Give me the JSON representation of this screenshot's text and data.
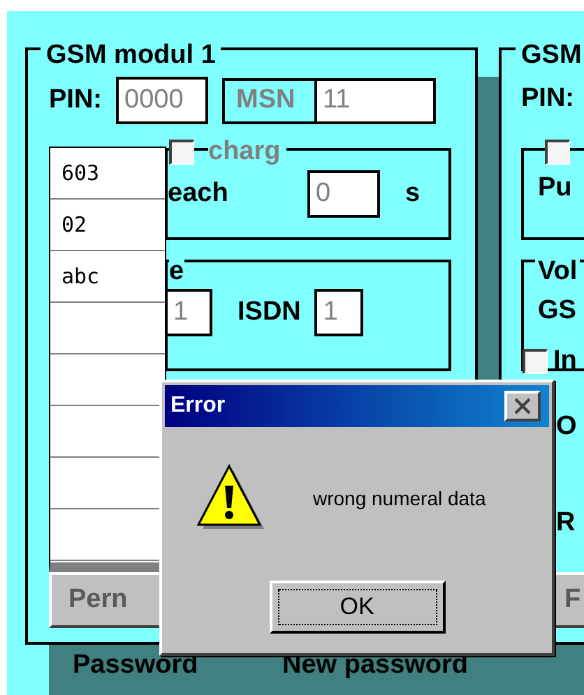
{
  "left_module": {
    "title": "GSM modul 1",
    "pin_label": "PIN:",
    "pin_value": "0000",
    "msn_label": "MSN",
    "msn_value": "11",
    "call_charge": {
      "label": "charg",
      "checked": false
    },
    "interval_label": "each",
    "interval_value": "0",
    "interval_unit": "s",
    "line_group_title": "e",
    "gsm_value": "1",
    "isdn_label": "ISDN",
    "isdn_value": "1",
    "button": "Pern"
  },
  "dropdown_list": {
    "items": [
      "603",
      "02",
      "abc"
    ]
  },
  "right_module": {
    "title": "GSM",
    "pin_label": "PIN:",
    "checkbox": {
      "checked": false
    },
    "group_label": "Pu",
    "volume_title": "Vol",
    "volume_label": "GS",
    "option": {
      "label": "In",
      "checked": false
    },
    "option_label": "O",
    "row_label": "R",
    "button": "F"
  },
  "bottom": {
    "password_label": "Password",
    "new_password_label": "New password"
  },
  "dialog": {
    "title": "Error",
    "message": "wrong numeral data",
    "button": "OK"
  }
}
